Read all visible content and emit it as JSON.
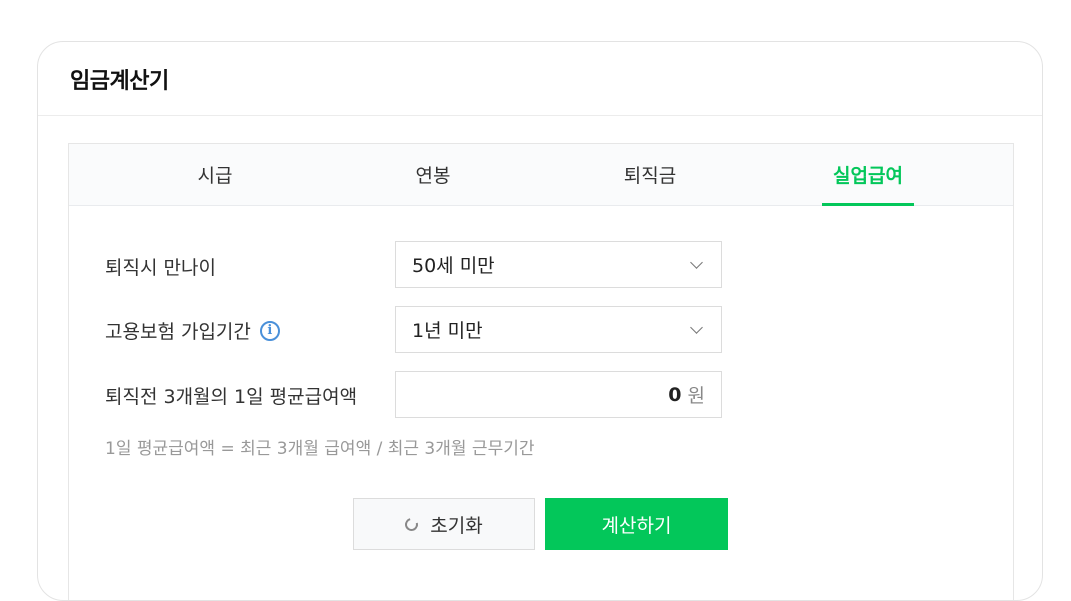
{
  "title": "임금계산기",
  "tabs": [
    {
      "label": "시급"
    },
    {
      "label": "연봉"
    },
    {
      "label": "퇴직금"
    },
    {
      "label": "실업급여"
    }
  ],
  "active_tab": "실업급여",
  "form": {
    "age": {
      "label": "퇴직시 만나이",
      "value": "50세 미만"
    },
    "insurance": {
      "label": "고용보험 가입기간",
      "value": "1년 미만",
      "info_icon": "info-icon"
    },
    "wage": {
      "label": "퇴직전 3개월의 1일 평균급여액",
      "value": "0",
      "unit": "원"
    }
  },
  "hint": "1일 평균급여액 = 최근 3개월 급여액 / 최근 3개월 근무기간",
  "buttons": {
    "reset": "초기화",
    "calculate": "계산하기"
  },
  "colors": {
    "accent": "#03c75a",
    "info": "#4a90d9"
  }
}
